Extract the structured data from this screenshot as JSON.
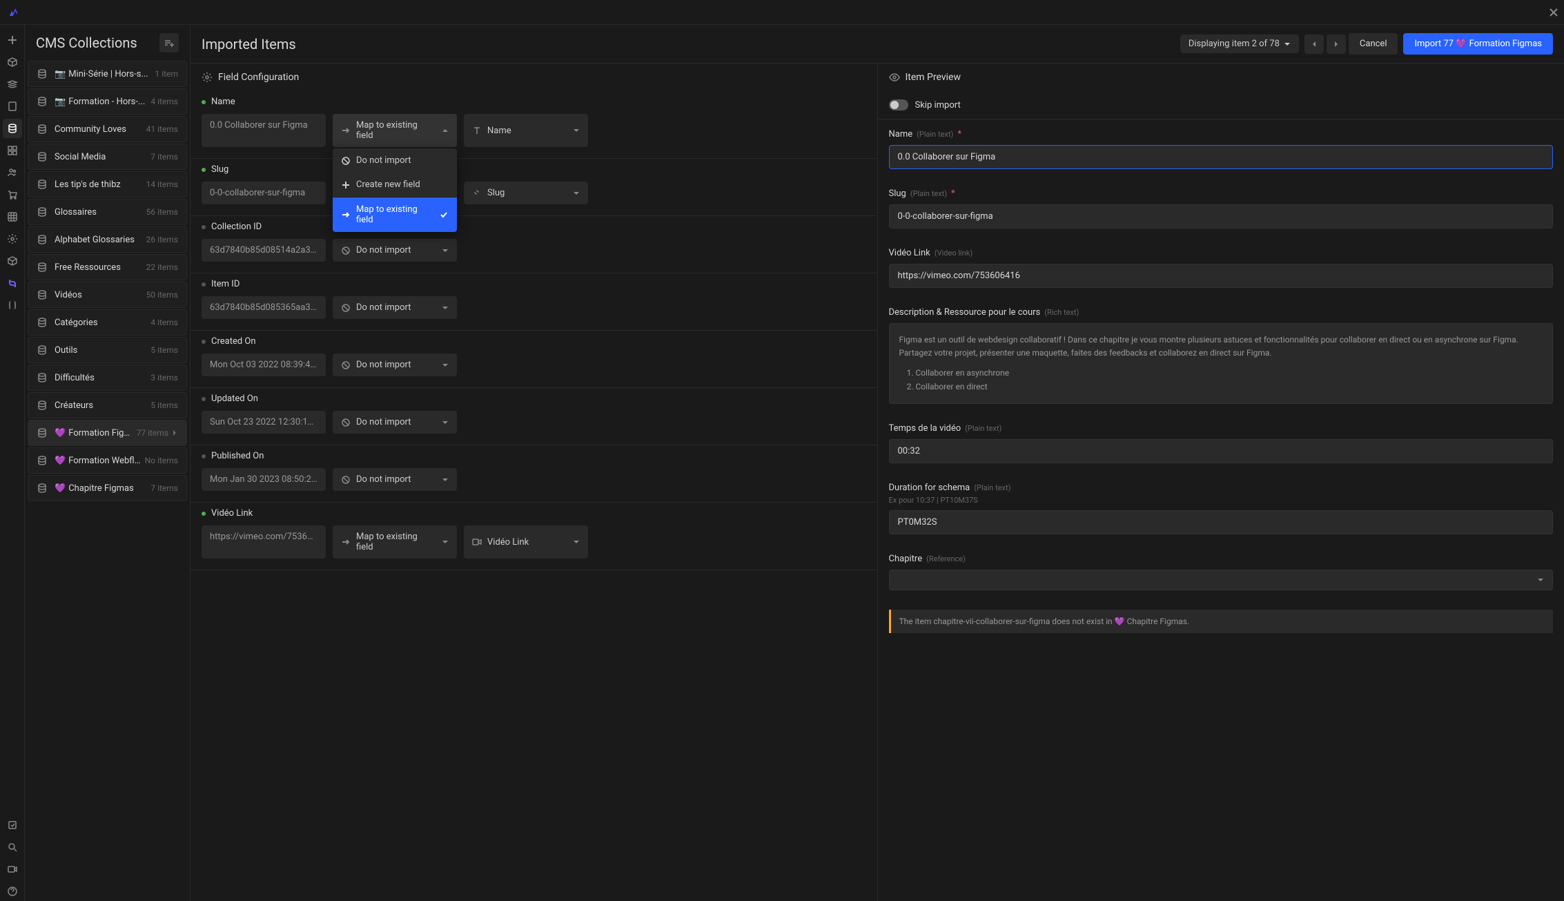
{
  "topbar": {
    "logo": "W"
  },
  "collections": {
    "title": "CMS Collections",
    "items": [
      {
        "prefix": "📷",
        "name": "Mini-Série | Hors-s...",
        "count": "1 item"
      },
      {
        "prefix": "📷",
        "name": "Formation - Hors-...",
        "count": "4 items"
      },
      {
        "prefix": "",
        "name": "Community Loves",
        "count": "41 items"
      },
      {
        "prefix": "",
        "name": "Social Media",
        "count": "7 items"
      },
      {
        "prefix": "",
        "name": "Les tip's de thibz",
        "count": "14 items"
      },
      {
        "prefix": "",
        "name": "Glossaires",
        "count": "56 items"
      },
      {
        "prefix": "",
        "name": "Alphabet Glossaries",
        "count": "26 items"
      },
      {
        "prefix": "",
        "name": "Free Ressources",
        "count": "22 items"
      },
      {
        "prefix": "",
        "name": "Vidéos",
        "count": "50 items"
      },
      {
        "prefix": "",
        "name": "Catégories",
        "count": "4 items"
      },
      {
        "prefix": "",
        "name": "Outils",
        "count": "5 items"
      },
      {
        "prefix": "",
        "name": "Difficultés",
        "count": "3 items"
      },
      {
        "prefix": "",
        "name": "Créateurs",
        "count": "5 items"
      },
      {
        "prefix": "💜",
        "name": "Formation Figm...",
        "count": "77 items",
        "active": true
      },
      {
        "prefix": "💜",
        "name": "Formation Webfl...",
        "count": "No items"
      },
      {
        "prefix": "💜",
        "name": "Chapitre Figmas",
        "count": "7 items"
      }
    ]
  },
  "imported": {
    "title": "Imported Items",
    "counter": "Displaying item 2 of 78",
    "cancel": "Cancel",
    "import_btn": "Import 77 💜 Formation Figmas"
  },
  "field_config": {
    "header": "Field Configuration",
    "fields": [
      {
        "label": "Name",
        "status": "green",
        "value": "0.0 Collaborer sur Figma",
        "map": "Map to existing field",
        "target": "Name",
        "target_icon": "text",
        "dropdown": true
      },
      {
        "label": "Slug",
        "status": "green",
        "value": "0-0-collaborer-sur-figma",
        "map": "",
        "target": "Slug",
        "target_icon": "link"
      },
      {
        "label": "Collection ID",
        "status": "gray",
        "value": "63d7840b85d08514a2a3dbf…",
        "map": "Do not import",
        "target": ""
      },
      {
        "label": "Item ID",
        "status": "gray",
        "value": "63d7840b85d085365aa3de3…",
        "map": "Do not import",
        "target": ""
      },
      {
        "label": "Created On",
        "status": "gray",
        "value": "Mon Oct 03 2022 08:39:42 G…",
        "map": "Do not import",
        "target": ""
      },
      {
        "label": "Updated On",
        "status": "gray",
        "value": "Sun Oct 23 2022 12:30:15 GM…",
        "map": "Do not import",
        "target": ""
      },
      {
        "label": "Published On",
        "status": "gray",
        "value": "Mon Jan 30 2023 08:50:28 G…",
        "map": "Do not import",
        "target": ""
      },
      {
        "label": "Vidéo Link",
        "status": "green",
        "value": "https://vimeo.com/75360641…",
        "map": "Map to existing field",
        "target": "Vidéo Link",
        "target_icon": "video"
      }
    ],
    "dropdown": {
      "opt1": "Do not import",
      "opt2": "Create new field",
      "opt3": "Map to existing field"
    }
  },
  "preview": {
    "header": "Item Preview",
    "skip": "Skip import",
    "fields": {
      "name": {
        "label": "Name",
        "type": "(Plain text)",
        "required": true,
        "value": "0.0 Collaborer sur Figma"
      },
      "slug": {
        "label": "Slug",
        "type": "(Plain text)",
        "required": true,
        "value": "0-0-collaborer-sur-figma"
      },
      "video": {
        "label": "Vidéo Link",
        "type": "(Video link)",
        "value": "https://vimeo.com/753606416"
      },
      "desc": {
        "label": "Description & Ressource pour le cours",
        "type": "(Rich text)",
        "body": "Figma est un outil de webdesign collaboratif ! Dans ce chapitre je vous montre plusieurs astuces et fonctionnalités pour collaborer en direct ou en asynchrone sur Figma. Partagez votre projet, présenter une maquette, faites des feedbacks et collaborez en direct sur Figma.",
        "li1": "Collaborer en asynchrone",
        "li2": "Collaborer en direct"
      },
      "temps": {
        "label": "Temps de la vidéo",
        "type": "(Plain text)",
        "value": "00:32"
      },
      "duration": {
        "label": "Duration for schema",
        "type": "(Plain text)",
        "hint": "Ex pour 10:37 | PT10M37S",
        "value": "PT0M32S"
      },
      "chapitre": {
        "label": "Chapitre",
        "type": "(Reference)",
        "value": ""
      }
    },
    "warning": "The item chapitre-vii-collaborer-sur-figma does not exist in 💜 Chapitre Figmas."
  }
}
